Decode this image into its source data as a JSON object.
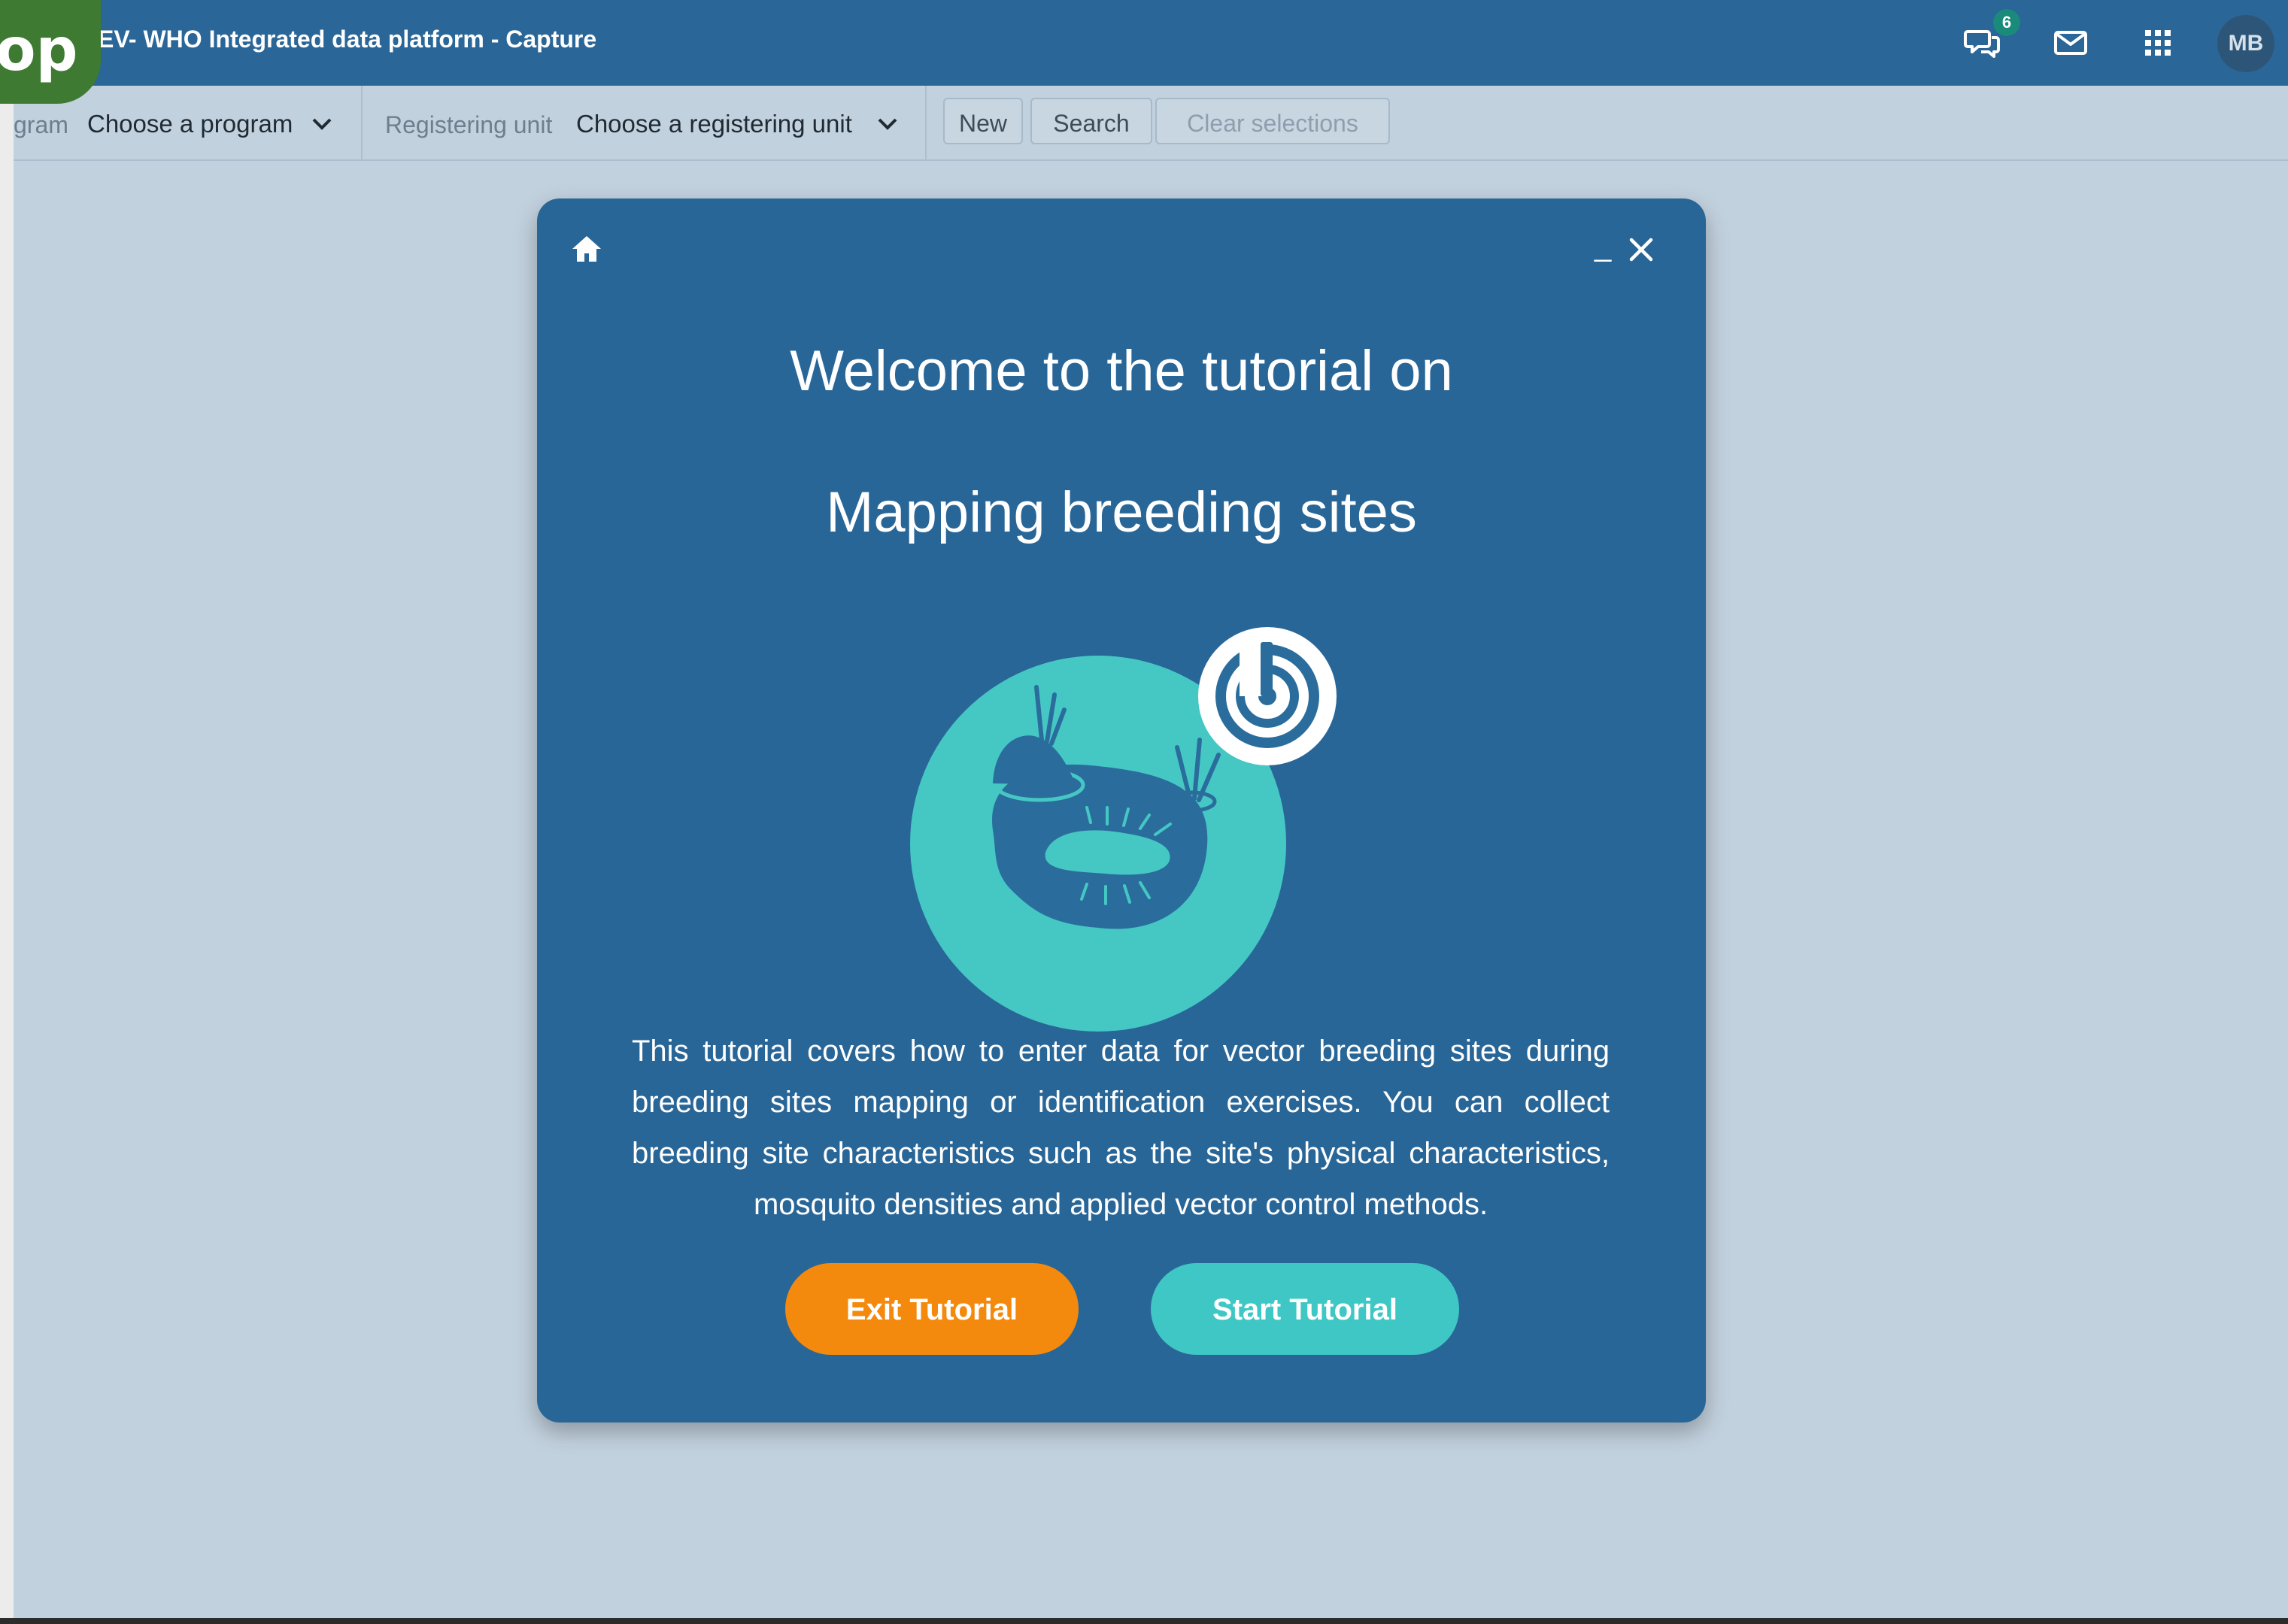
{
  "app": {
    "badge_text": "op",
    "title": "EV- WHO Integrated data platform - Capture"
  },
  "header": {
    "icons": [
      "interpretations-icon",
      "messages-icon",
      "apps-grid-icon"
    ],
    "interpretations_count": "6",
    "user_initials": "MB"
  },
  "toolbar": {
    "program_label": "gram",
    "program_value": "Choose a program",
    "registering_unit_label": "Registering unit",
    "registering_unit_value": "Choose a registering unit",
    "new_label": "New",
    "search_label": "Search",
    "clear_label": "Clear selections"
  },
  "modal": {
    "title_line1": "Welcome to the tutorial on",
    "title_line2": "Mapping breeding sites",
    "minimize_symbol": "_",
    "description": "This tutorial covers how to enter data for vector breeding sites during breeding sites mapping or identification exercises. You can collect breeding site characteristics such as the site's physical characteristics, mosquito densities and applied vector control methods.",
    "exit_label": "Exit Tutorial",
    "start_label": "Start Tutorial"
  },
  "colors": {
    "header_bg": "#2a6697",
    "page_bg": "#c2d1de",
    "modal_bg": "#296698",
    "exit_button": "#f48a0d",
    "start_button": "#3ec7c4",
    "badge_green": "#3f7a32"
  }
}
